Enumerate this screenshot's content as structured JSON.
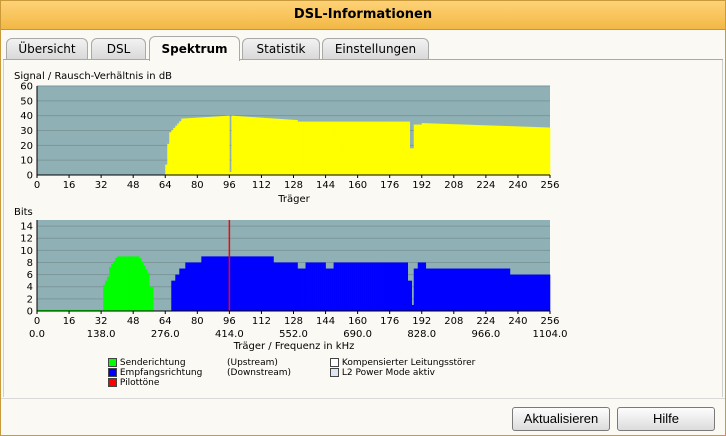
{
  "window": {
    "title": "DSL-Informationen"
  },
  "tabs": [
    {
      "label": "Übersicht",
      "active": false
    },
    {
      "label": "DSL",
      "active": false
    },
    {
      "label": "Spektrum",
      "active": true
    },
    {
      "label": "Statistik",
      "active": false
    },
    {
      "label": "Einstellungen",
      "active": false
    }
  ],
  "chart_data": [
    {
      "type": "bar",
      "ylabel": "Signal / Rausch-Verhältnis in dB",
      "xlabel": "Träger",
      "ylim": [
        0,
        60
      ],
      "yticks": [
        0,
        10,
        20,
        30,
        40,
        50,
        60
      ],
      "xlim": [
        0,
        256
      ],
      "xticks": [
        0,
        16,
        32,
        48,
        64,
        80,
        96,
        112,
        128,
        144,
        160,
        176,
        192,
        208,
        224,
        240,
        256
      ],
      "grid": true,
      "colors": {
        "plot_bg": "#8fb1b6",
        "series": "#ffff00",
        "grid": "#9a9a9a"
      },
      "series": [
        {
          "values_piecewise": [
            {
              "x": [
                0,
                64
              ],
              "y": 0
            },
            {
              "x": [
                64,
                66
              ],
              "y": [
                0,
                28
              ]
            },
            {
              "x": [
                66,
                72
              ],
              "y": [
                28,
                37
              ]
            },
            {
              "x": [
                72,
                96
              ],
              "y": [
                38,
                40
              ]
            },
            {
              "x": [
                96,
                97
              ],
              "y": 2
            },
            {
              "x": [
                97,
                130
              ],
              "y": [
                40,
                37
              ]
            },
            {
              "x": [
                130,
                186
              ],
              "y": 36
            },
            {
              "x": [
                186,
                188
              ],
              "y": 18
            },
            {
              "x": [
                188,
                192
              ],
              "y": 34
            },
            {
              "x": [
                192,
                256
              ],
              "y": [
                35,
                32
              ]
            }
          ]
        }
      ]
    },
    {
      "type": "bar",
      "ylabel": "Bits",
      "xlabel": "Träger / Frequenz in kHz",
      "ylim": [
        0,
        15
      ],
      "yticks": [
        0,
        2,
        4,
        6,
        8,
        10,
        12,
        14
      ],
      "xlim": [
        0,
        256
      ],
      "xticks": [
        0,
        16,
        32,
        48,
        64,
        80,
        96,
        112,
        128,
        144,
        160,
        176,
        192,
        208,
        224,
        240,
        256
      ],
      "xticks_khz": [
        "0.0",
        "138.0",
        "276.0",
        "414.0",
        "552.0",
        "690.0",
        "828.0",
        "966.0",
        "1104.0"
      ],
      "grid": true,
      "colors": {
        "plot_bg": "#8fb1b6",
        "upstream": "#00ff00",
        "downstream": "#0000ff",
        "pilot": "#ff0000"
      },
      "series": [
        {
          "name": "Senderichtung",
          "color": "#00ff00",
          "values_piecewise": [
            {
              "x": [
                0,
                32
              ],
              "y": 0.2
            },
            {
              "x": [
                33,
                36
              ],
              "y": [
                4,
                6
              ]
            },
            {
              "x": [
                36,
                40
              ],
              "y": [
                7,
                9
              ]
            },
            {
              "x": [
                40,
                51
              ],
              "y": 9
            },
            {
              "x": [
                51,
                56
              ],
              "y": [
                9,
                6
              ]
            },
            {
              "x": [
                56,
                58
              ],
              "y": 4
            }
          ]
        },
        {
          "name": "Empfangsrichtung",
          "color": "#0000ff",
          "values_piecewise": [
            {
              "x": [
                67,
                69
              ],
              "y": 5
            },
            {
              "x": [
                69,
                71
              ],
              "y": 6
            },
            {
              "x": [
                71,
                74
              ],
              "y": 7
            },
            {
              "x": [
                74,
                82
              ],
              "y": 8
            },
            {
              "x": [
                82,
                118
              ],
              "y": 9
            },
            {
              "x": [
                118,
                130
              ],
              "y": 8
            },
            {
              "x": [
                130,
                134
              ],
              "y": 7
            },
            {
              "x": [
                134,
                144
              ],
              "y": 8
            },
            {
              "x": [
                144,
                148
              ],
              "y": 7
            },
            {
              "x": [
                148,
                185
              ],
              "y": 8
            },
            {
              "x": [
                185,
                187
              ],
              "y": 5
            },
            {
              "x": [
                187,
                188
              ],
              "y": 1
            },
            {
              "x": [
                188,
                190
              ],
              "y": 7
            },
            {
              "x": [
                190,
                194
              ],
              "y": 8
            },
            {
              "x": [
                194,
                236
              ],
              "y": 7
            },
            {
              "x": [
                236,
                256
              ],
              "y": 6
            }
          ]
        },
        {
          "name": "Pilottöne",
          "color": "#ff0000",
          "markers": [
            96
          ]
        }
      ]
    }
  ],
  "legend": {
    "items": [
      {
        "label": "Senderichtung",
        "note": "(Upstream)",
        "color": "#00ff00"
      },
      {
        "label": "Empfangsrichtung",
        "note": "(Downstream)",
        "color": "#0000ff"
      },
      {
        "label": "Pilottöne",
        "note": "",
        "color": "#ff0000"
      },
      {
        "label": "Kompensierter Leitungsstörer",
        "note": "",
        "color": "#ffffff"
      },
      {
        "label": "L2 Power Mode aktiv",
        "note": "",
        "color": "#dde6f2"
      }
    ]
  },
  "buttons": {
    "refresh": "Aktualisieren",
    "help": "Hilfe"
  }
}
